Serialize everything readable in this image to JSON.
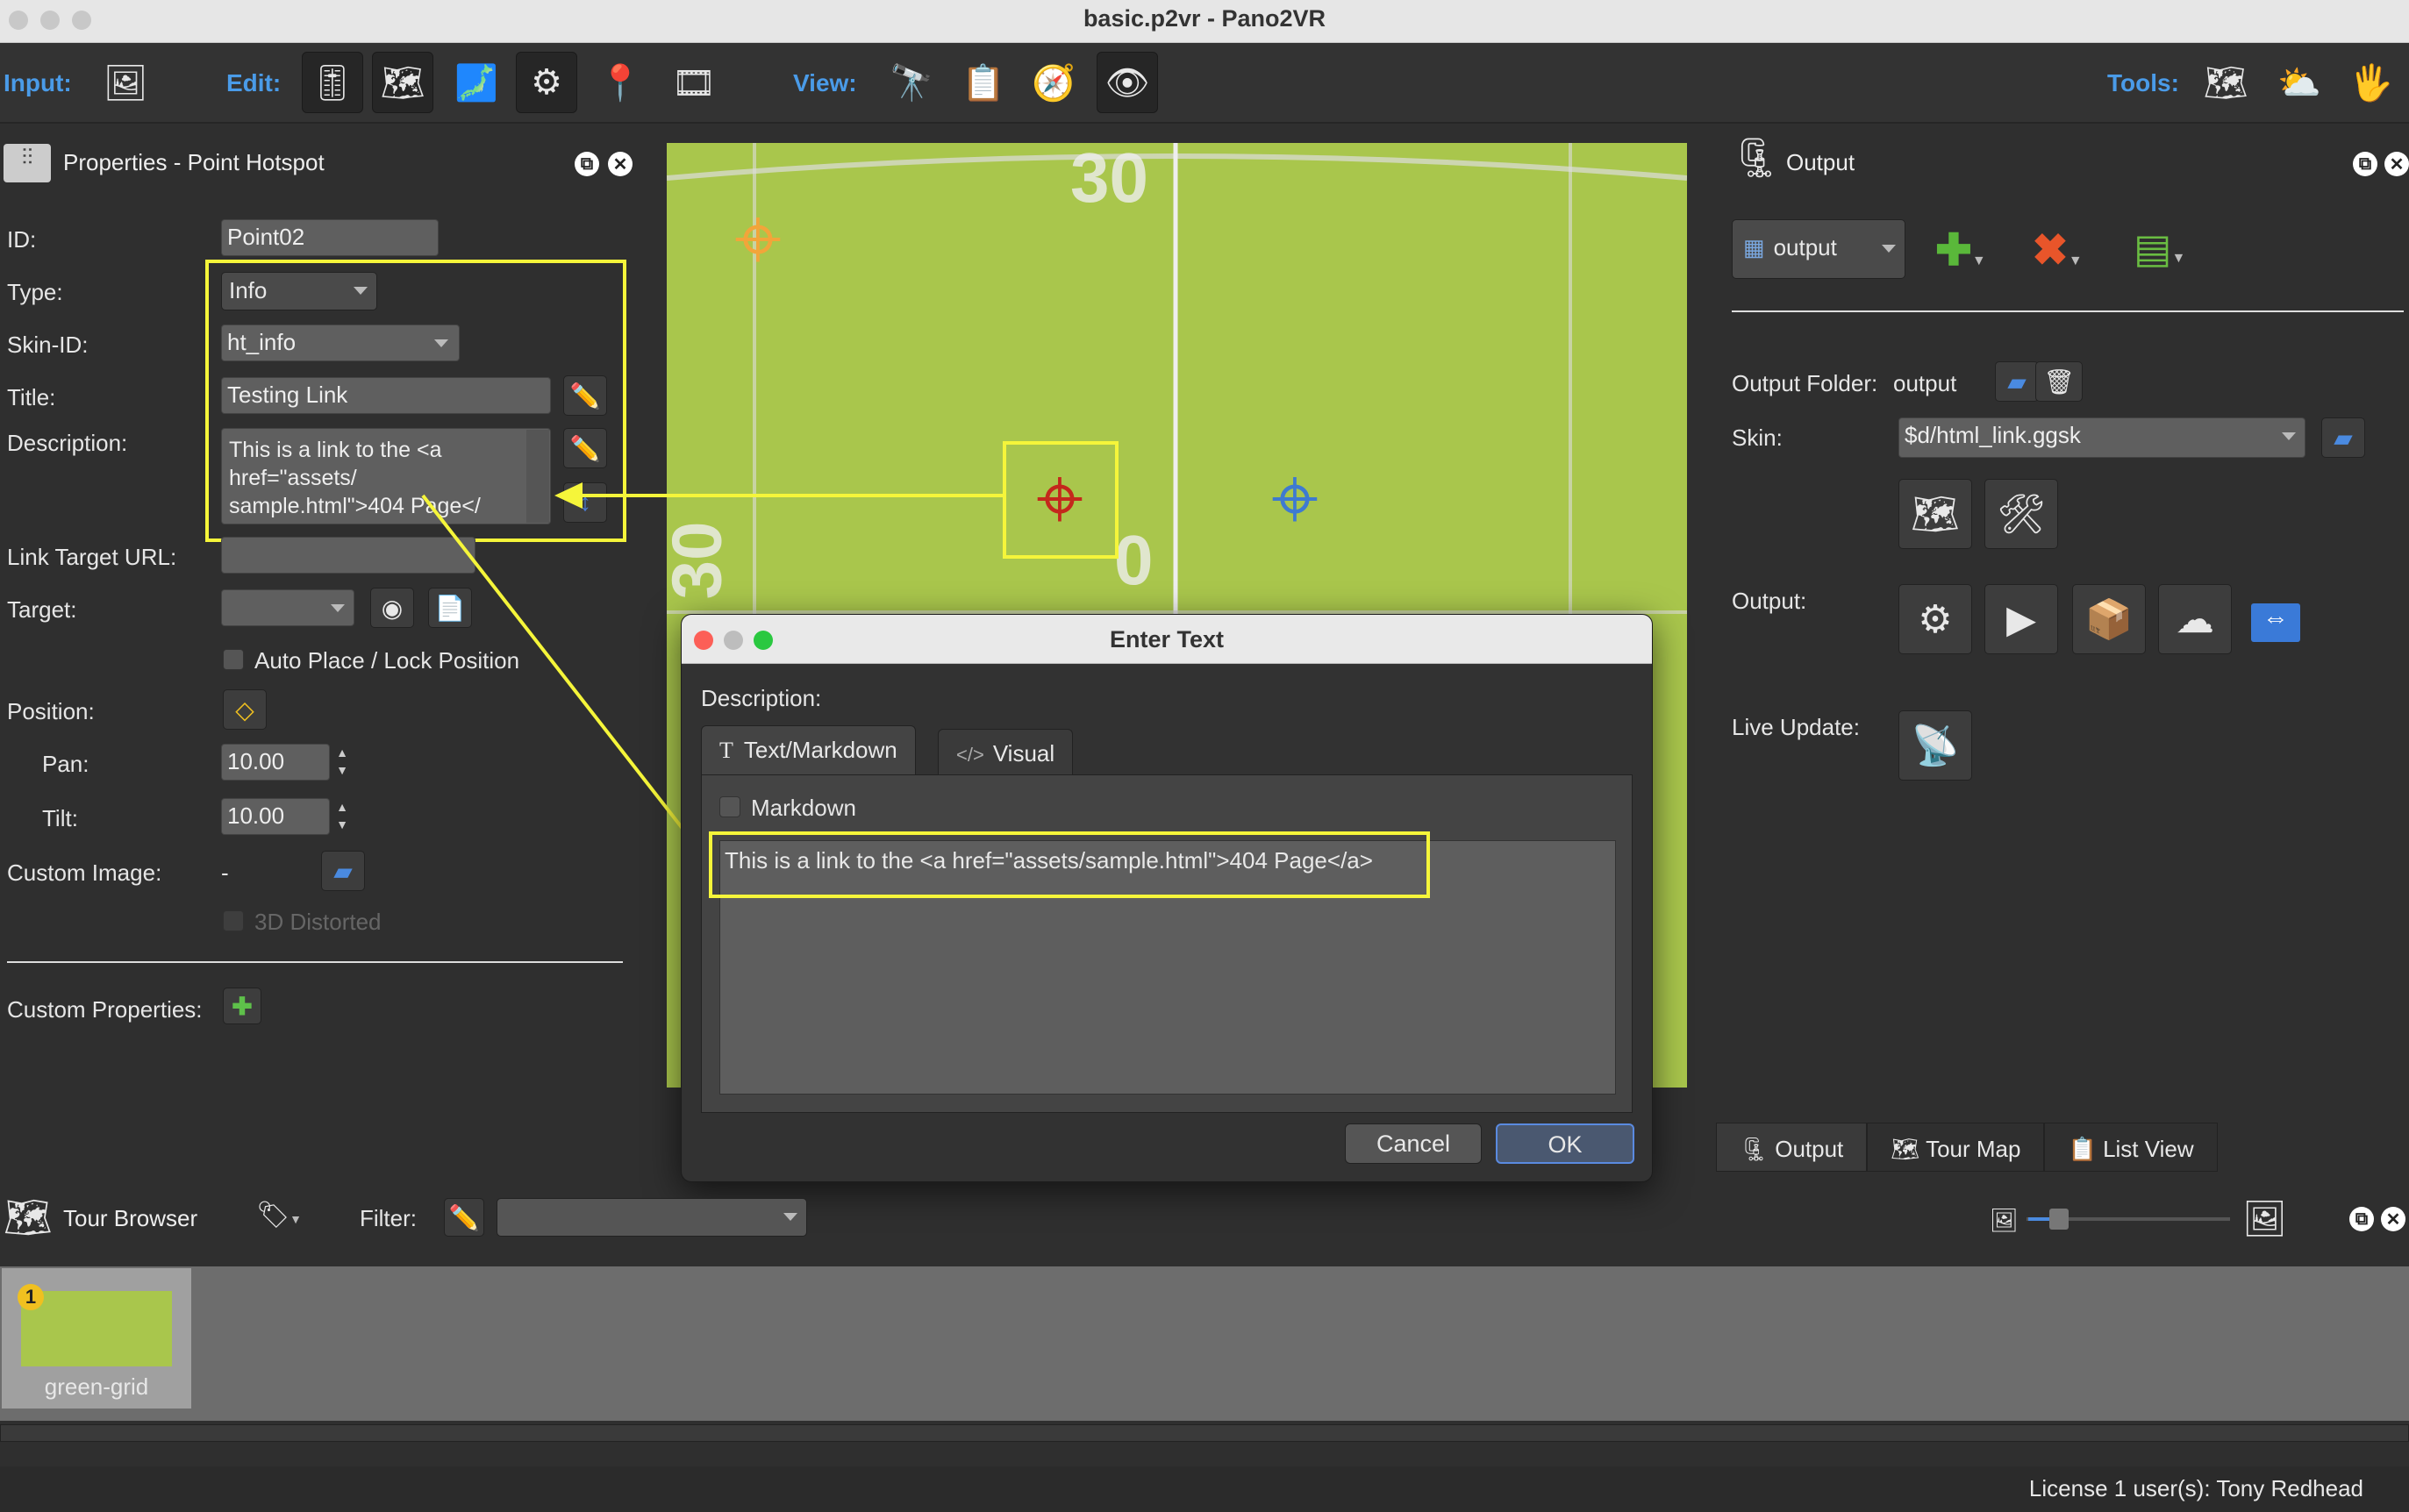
{
  "window": {
    "title": "basic.p2vr - Pano2VR"
  },
  "toolbar": {
    "input_label": "Input:",
    "edit_label": "Edit:",
    "view_label": "View:",
    "tools_label": "Tools:"
  },
  "properties": {
    "title": "Properties - Point Hotspot",
    "id_label": "ID:",
    "id_value": "Point02",
    "type_label": "Type:",
    "type_value": "Info",
    "skin_id_label": "Skin-ID:",
    "skin_id_value": "ht_info",
    "title_label": "Title:",
    "title_value": "Testing Link",
    "description_label": "Description:",
    "description_value": "This is a link to the <a href=\"assets/ sample.html\">404 Page</",
    "link_url_label": "Link Target URL:",
    "link_url_value": "",
    "target_label": "Target:",
    "target_value": "",
    "auto_place_label": "Auto Place / Lock Position",
    "position_label": "Position:",
    "pan_label": "Pan:",
    "pan_value": "10.00",
    "tilt_label": "Tilt:",
    "tilt_value": "10.00",
    "custom_image_label": "Custom Image:",
    "custom_image_value": "-",
    "distorted_label": "3D Distorted",
    "custom_props_label": "Custom Properties:"
  },
  "viewer": {
    "marks": [
      "30",
      "30",
      "0"
    ]
  },
  "dialog": {
    "title": "Enter Text",
    "description_label": "Description:",
    "tabs": [
      {
        "label": "Text/Markdown",
        "icon": "T"
      },
      {
        "label": "Visual",
        "icon": "</>"
      }
    ],
    "markdown_label": "Markdown",
    "text": "This is a link to the <a href=\"assets/sample.html\">404 Page</a>",
    "cancel": "Cancel",
    "ok": "OK"
  },
  "output": {
    "title": "Output",
    "output_select": "output",
    "folder_label": "Output Folder:",
    "folder_value": "output",
    "skin_label": "Skin:",
    "skin_value": "$d/html_link.ggsk",
    "output_label": "Output:",
    "live_update_label": "Live Update:",
    "tabs": [
      "Output",
      "Tour Map",
      "List View"
    ]
  },
  "tour_browser": {
    "title": "Tour Browser",
    "filter_label": "Filter:",
    "filter_value": "",
    "items": [
      {
        "badge": "1",
        "label": "green-grid"
      }
    ]
  },
  "status": {
    "license": "License 1 user(s): Tony Redhead"
  },
  "colors": {
    "accent": "#4a9be8",
    "highlight": "#f5f53a",
    "viewer_green": "#a9c64c"
  }
}
